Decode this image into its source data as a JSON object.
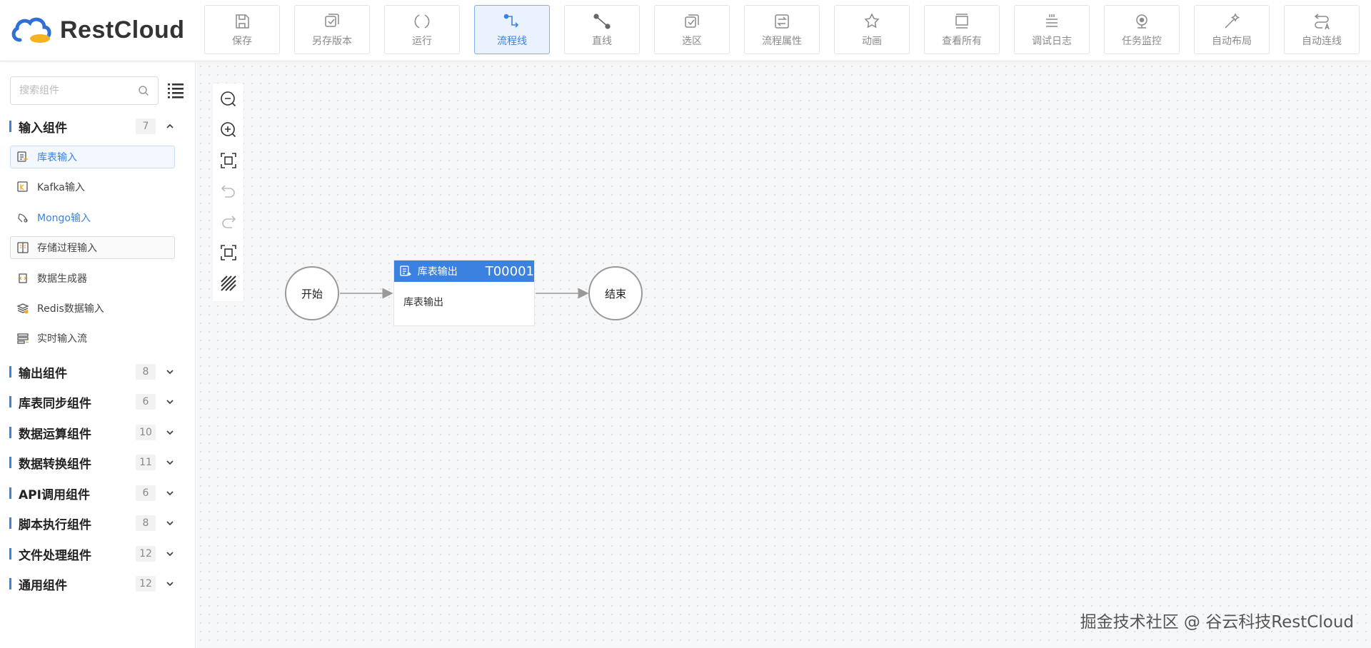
{
  "app": {
    "logo_text": "RestCloud"
  },
  "toolbar": {
    "buttons": [
      {
        "label": "保存",
        "icon": "save-icon"
      },
      {
        "label": "另存版本",
        "icon": "save-version-icon"
      },
      {
        "label": "运行",
        "icon": "run-icon"
      },
      {
        "label": "流程线",
        "icon": "flow-line-icon",
        "active": true
      },
      {
        "label": "直线",
        "icon": "straight-line-icon"
      },
      {
        "label": "选区",
        "icon": "select-area-icon"
      },
      {
        "label": "流程属性",
        "icon": "flow-properties-icon"
      },
      {
        "label": "动画",
        "icon": "animation-icon"
      },
      {
        "label": "查看所有",
        "icon": "view-all-icon"
      },
      {
        "label": "调试日志",
        "icon": "debug-log-icon"
      },
      {
        "label": "任务监控",
        "icon": "task-monitor-icon"
      },
      {
        "label": "自动布局",
        "icon": "auto-layout-icon"
      },
      {
        "label": "自动连线",
        "icon": "auto-connect-icon"
      }
    ]
  },
  "sidebar": {
    "search_placeholder": "搜索组件",
    "categories": [
      {
        "name": "输入组件",
        "count": "7",
        "expanded": true,
        "items": [
          "库表输入",
          "Kafka输入",
          "Mongo输入",
          "存储过程输入",
          "数据生成器",
          "Redis数据输入",
          "实时输入流"
        ]
      },
      {
        "name": "输出组件",
        "count": "8"
      },
      {
        "name": "库表同步组件",
        "count": "6"
      },
      {
        "name": "数据运算组件",
        "count": "10"
      },
      {
        "name": "数据转换组件",
        "count": "11"
      },
      {
        "name": "API调用组件",
        "count": "6"
      },
      {
        "name": "脚本执行组件",
        "count": "8"
      },
      {
        "name": "文件处理组件",
        "count": "12"
      },
      {
        "name": "通用组件",
        "count": "12"
      }
    ]
  },
  "canvas": {
    "start_label": "开始",
    "end_label": "结束",
    "task": {
      "title": "库表输出",
      "id": "T00001",
      "body": "库表输出"
    },
    "watermark": "掘金技术社区 @ 谷云科技RestCloud"
  },
  "colors": {
    "accent": "#3b82e0",
    "canvas_bg": "#f6f7f9"
  }
}
